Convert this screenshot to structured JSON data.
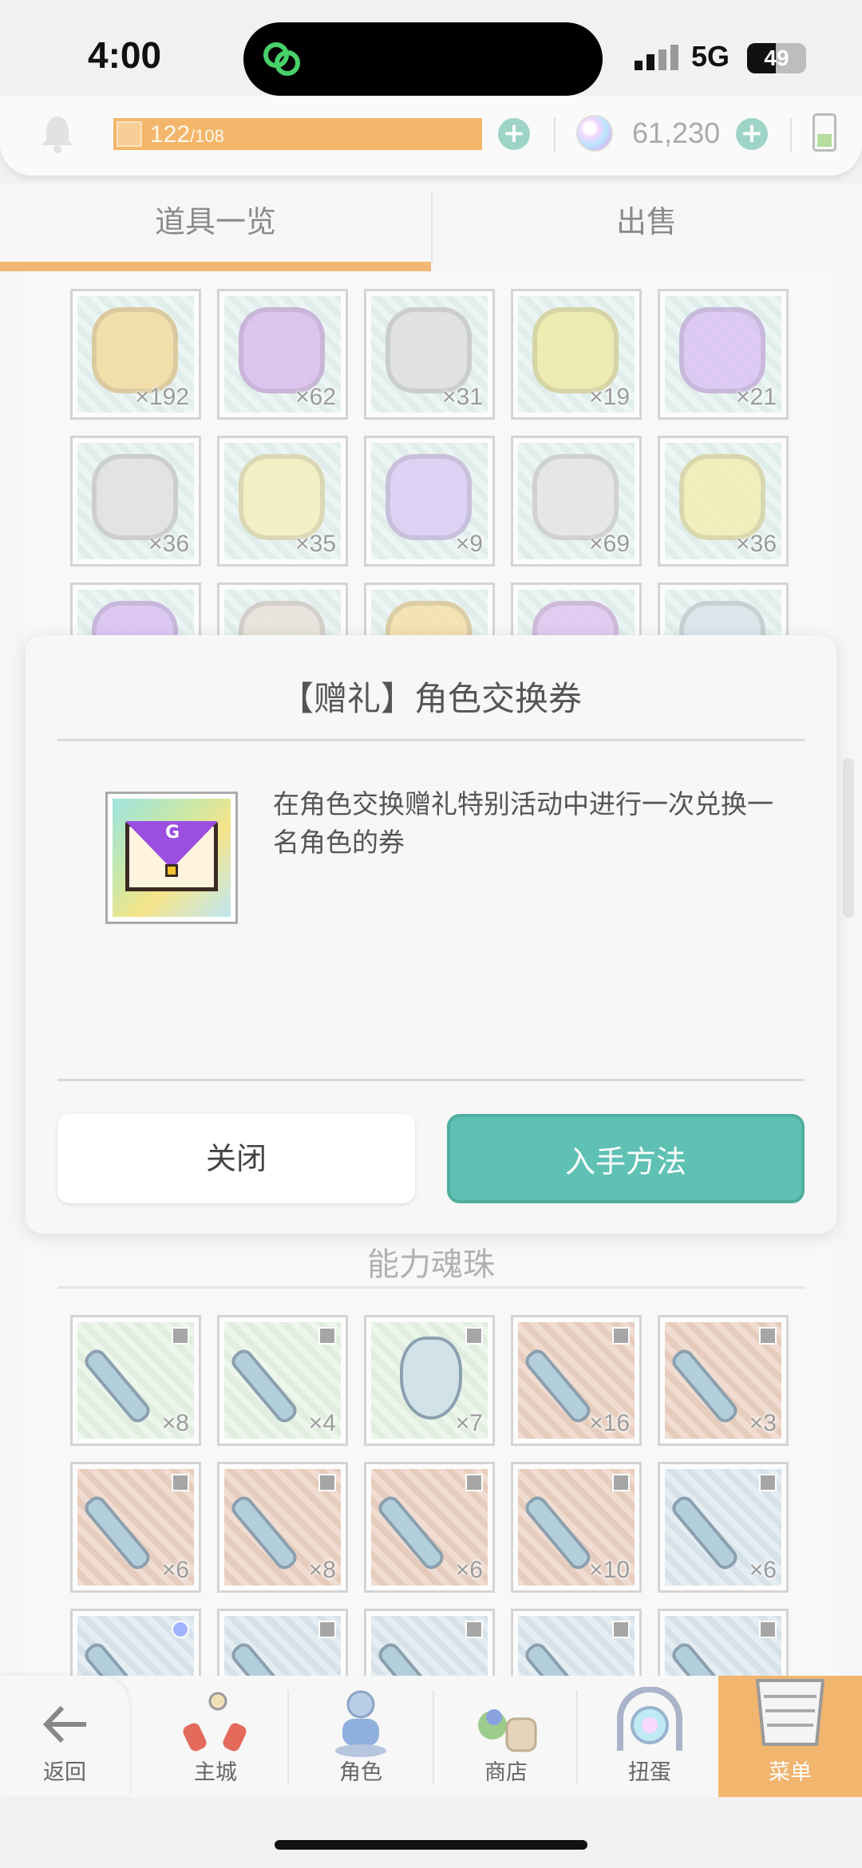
{
  "status": {
    "time": "4:00",
    "network": "5G",
    "battery": "49",
    "battery_level": 0.49
  },
  "resources": {
    "stamina": "122",
    "stamina_max": "/108",
    "gems": "61,230"
  },
  "tabs": [
    {
      "label": "道具一览"
    },
    {
      "label": "出售"
    }
  ],
  "grid_top": {
    "rows": [
      [
        {
          "count": "×192",
          "color": "#f0c96b"
        },
        {
          "count": "×62",
          "color": "#c99be6"
        },
        {
          "count": "×31",
          "color": "#cfd0cf"
        },
        {
          "count": "×19",
          "color": "#e6e07a"
        },
        {
          "count": "×21",
          "color": "#c9a3ef"
        }
      ],
      [
        {
          "count": "×36",
          "color": "#d2d2d2"
        },
        {
          "count": "×35",
          "color": "#efe79a"
        },
        {
          "count": "×9",
          "color": "#c9b3f0"
        },
        {
          "count": "×69",
          "color": "#d8d8d8"
        },
        {
          "count": "×36",
          "color": "#eee48c"
        }
      ],
      [
        {
          "count": "",
          "color": "#c9a0ee"
        },
        {
          "count": "",
          "color": "#e0d2c8"
        },
        {
          "count": "",
          "color": "#f1cf7a"
        },
        {
          "count": "",
          "color": "#d3a6ea"
        },
        {
          "count": "",
          "color": "#c8d5df"
        }
      ]
    ]
  },
  "section": {
    "title": "能力魂珠"
  },
  "grid_bottom": {
    "rows": [
      [
        {
          "count": "×8",
          "bg": "#d8ecd6"
        },
        {
          "count": "×4",
          "bg": "#d8ecd6"
        },
        {
          "count": "×7",
          "bg": "#d8ecd6"
        },
        {
          "count": "×16",
          "bg": "#e2b89f"
        },
        {
          "count": "×3",
          "bg": "#e2b89f"
        }
      ],
      [
        {
          "count": "×6",
          "bg": "#e2b89f"
        },
        {
          "count": "×8",
          "bg": "#e2b89f"
        },
        {
          "count": "×6",
          "bg": "#e2b89f"
        },
        {
          "count": "×10",
          "bg": "#e2b89f"
        },
        {
          "count": "×6",
          "bg": "#c9dbe6"
        }
      ],
      [
        {
          "count": "",
          "bg": "#c9dbe6"
        },
        {
          "count": "",
          "bg": "#c9dbe6"
        },
        {
          "count": "",
          "bg": "#c9dbe6"
        },
        {
          "count": "",
          "bg": "#c9dbe6"
        },
        {
          "count": "",
          "bg": "#c9dbe6"
        }
      ]
    ]
  },
  "dialog": {
    "title": "【赠礼】角色交换券",
    "description": "在角色交换赠礼特别活动中进行一次兑换一名角色的券",
    "icon_letter": "G",
    "close_label": "关闭",
    "acquire_label": "入手方法"
  },
  "nav": [
    {
      "label": "返回",
      "icon": "back-arrow-icon"
    },
    {
      "label": "主城",
      "icon": "castle-icon"
    },
    {
      "label": "角色",
      "icon": "character-icon"
    },
    {
      "label": "商店",
      "icon": "shop-icon"
    },
    {
      "label": "扭蛋",
      "icon": "gacha-icon"
    },
    {
      "label": "菜单",
      "icon": "menu-icon"
    }
  ],
  "colors": {
    "accent": "#f2b56e",
    "primary_button": "#5fc1b3"
  }
}
